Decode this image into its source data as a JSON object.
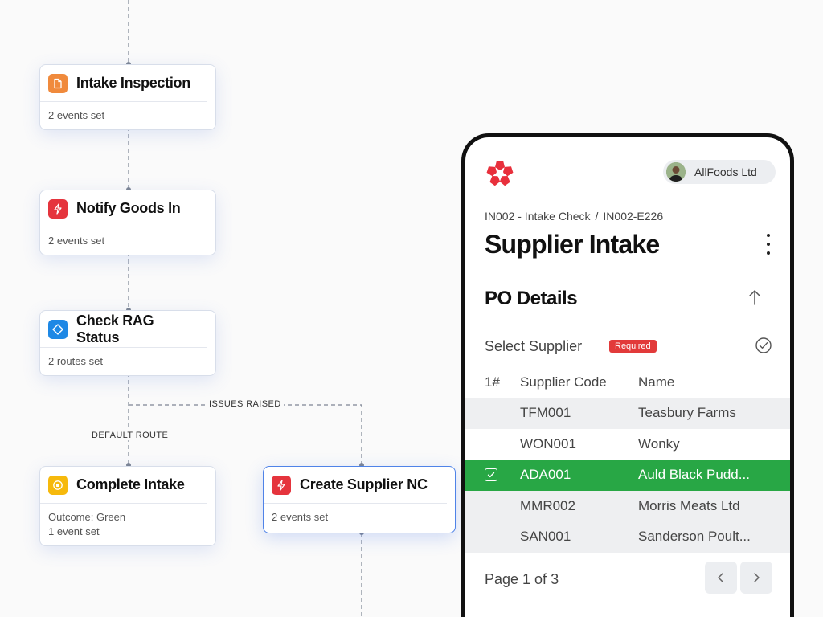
{
  "workflow": {
    "nodes": [
      {
        "title": "Intake Inspection",
        "icon": "document-icon",
        "icon_color": "#f08a3c",
        "lines": [
          "2 events set"
        ]
      },
      {
        "title": "Notify Goods In",
        "icon": "lightning-icon",
        "icon_color": "#e5343d",
        "lines": [
          "2 events set"
        ]
      },
      {
        "title": "Check RAG Status",
        "icon": "diamond-icon",
        "icon_color": "#1e88e5",
        "lines": [
          "2 routes set"
        ]
      },
      {
        "title": "Complete Intake",
        "icon": "stop-icon",
        "icon_color": "#f6b90c",
        "lines": [
          "Outcome: Green",
          "1 event set"
        ]
      },
      {
        "title": "Create Supplier NC",
        "icon": "lightning-icon",
        "icon_color": "#e5343d",
        "lines": [
          "2 events set"
        ],
        "active": true
      }
    ],
    "routes": {
      "default": "DEFAULT ROUTE",
      "issues": "ISSUES RAISED"
    }
  },
  "app": {
    "brand_color": "#e8303c",
    "org_name": "AllFoods Ltd",
    "breadcrumb": [
      "IN002 - Intake Check",
      "/",
      "IN002-E226"
    ],
    "page_title": "Supplier Intake",
    "section_title": "PO Details",
    "field_label": "Select Supplier",
    "required_label": "Required",
    "table": {
      "columns": [
        "1#",
        "Supplier Code",
        "Name"
      ],
      "rows": [
        {
          "code": "TFM001",
          "name": "Teasbury Farms",
          "selected": false
        },
        {
          "code": "WON001",
          "name": "Wonky",
          "selected": false
        },
        {
          "code": "ADA001",
          "name": "Auld Black Pudd...",
          "selected": true
        },
        {
          "code": "MMR002",
          "name": "Morris Meats Ltd",
          "selected": false
        },
        {
          "code": "SAN001",
          "name": "Sanderson Poult...",
          "selected": false
        }
      ]
    },
    "pager_label": "Page 1 of 3",
    "selected_color": "#28a745"
  }
}
